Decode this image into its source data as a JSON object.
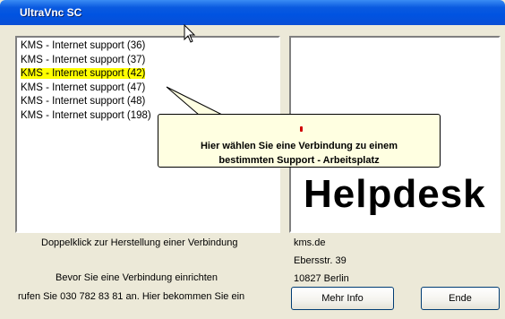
{
  "window": {
    "title": "UltraVnc SC"
  },
  "connections": {
    "items": [
      "KMS - Internet support (36)",
      "KMS - Internet support (37)",
      "KMS - Internet support (42)",
      "KMS - Internet support (47)",
      "KMS - Internet support (48)",
      "KMS - Internet support (198)"
    ],
    "selected_index": 2,
    "highlight_color": "#ffff00"
  },
  "logo": {
    "text": "Helpdesk"
  },
  "tooltip": {
    "line1": "Hier wählen Sie eine Verbindung zu einem",
    "line2": "bestimmten Support - Arbeitsplatz",
    "background": "#ffffe1"
  },
  "instructions": {
    "doubleclick": "Doppelklick zur Herstellung einer Verbindung",
    "before": "Bevor Sie eine Verbindung einrichten",
    "call": "rufen Sie  030 782 83 81 an. Hier bekommen Sie ein"
  },
  "contact": {
    "domain": "kms.de",
    "street": "Ebersstr. 39",
    "city": "10827 Berlin"
  },
  "buttons": {
    "more_info": "Mehr Info",
    "end": "Ende"
  },
  "colors": {
    "titlebar": "#0053e1",
    "dialog_bg": "#ece9d8"
  }
}
